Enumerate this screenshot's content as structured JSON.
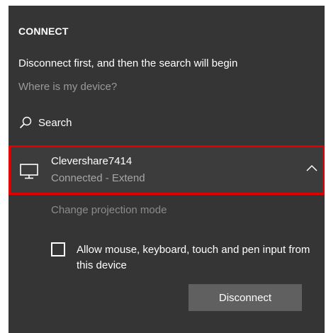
{
  "connect_panel": {
    "title": "CONNECT",
    "message": "Disconnect first, and then the search will begin",
    "help_link": "Where is my device?",
    "search_label": "Search",
    "device": {
      "name": "Clevershare7414",
      "status": "Connected - Extend",
      "icon": "monitor-icon",
      "expanded": true
    },
    "change_projection_label": "Change projection mode",
    "allow_input": {
      "label": "Allow mouse, keyboard, touch and pen input from this device",
      "checked": false
    },
    "disconnect_label": "Disconnect"
  },
  "colors": {
    "panel_background": "#353535",
    "highlight_border": "#e00000",
    "button_background": "#606060",
    "muted_text": "#9a9a9a"
  }
}
